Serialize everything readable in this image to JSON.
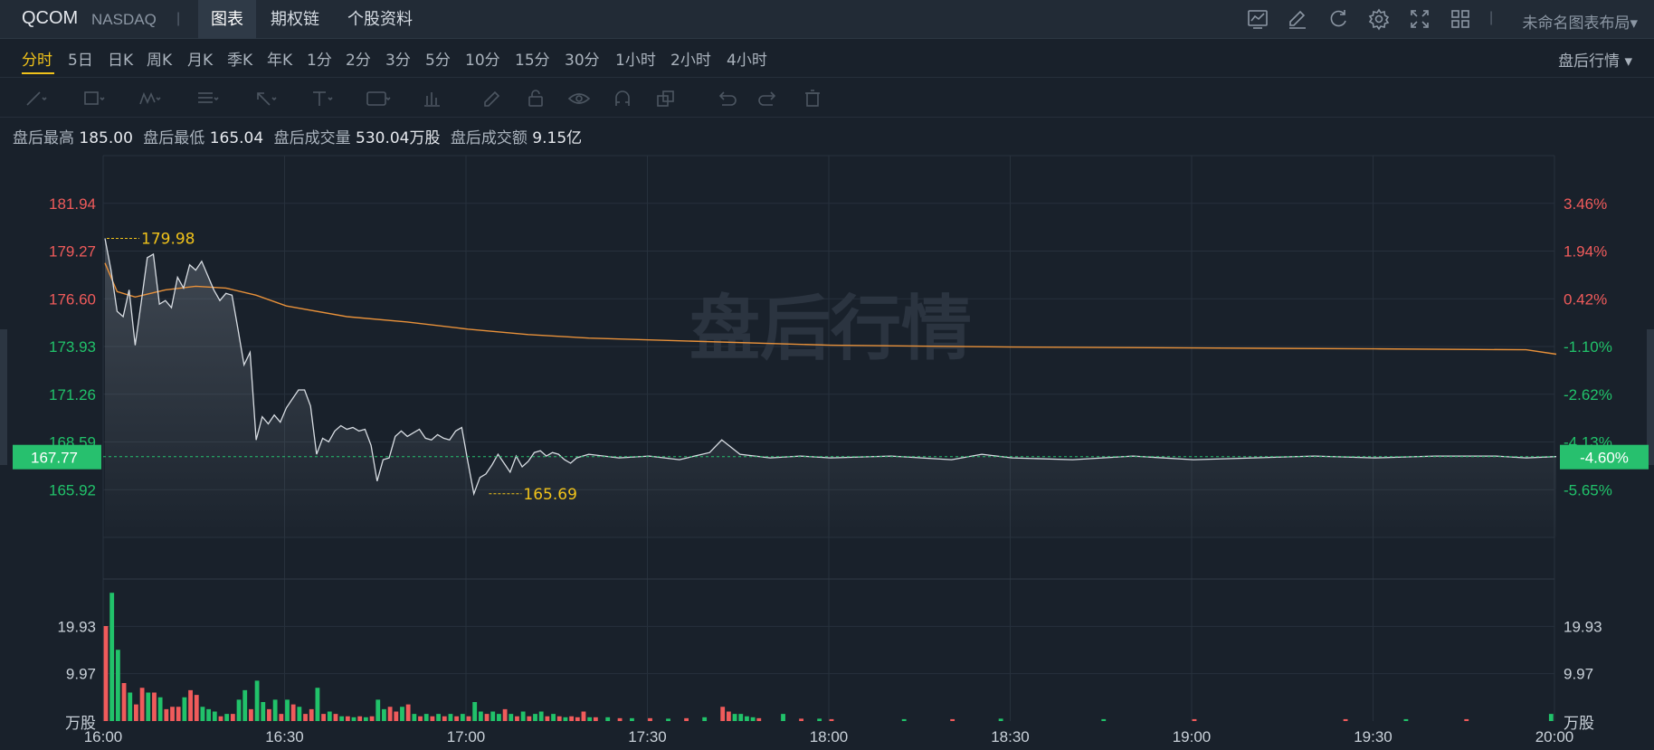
{
  "header": {
    "symbol": "QCOM",
    "exchange": "NASDAQ",
    "separator": "|",
    "tabs": [
      {
        "label": "图表",
        "active": true
      },
      {
        "label": "期权链",
        "active": false
      },
      {
        "label": "个股资料",
        "active": false
      }
    ],
    "icons": [
      "chart-type-icon",
      "draw-icon",
      "refresh-icon",
      "settings-icon",
      "fullscreen-icon",
      "layout-grid-icon"
    ],
    "layout_name": "未命名图表布局▾"
  },
  "periods": {
    "items": [
      "分时",
      "5日",
      "日K",
      "周K",
      "月K",
      "季K",
      "年K",
      "1分",
      "2分",
      "3分",
      "5分",
      "10分",
      "15分",
      "30分",
      "1小时",
      "2小时",
      "4小时"
    ],
    "active": "分时",
    "session_select": "盘后行情  ▾"
  },
  "drawing_tools": [
    "line-tool-icon",
    "rect-tool-icon",
    "wave-tool-icon",
    "fib-tool-icon",
    "arrow-tool-icon",
    "text-tool-icon",
    "label-tool-icon",
    "measure-tool-icon",
    "pen-tool-icon",
    "lock-icon",
    "eye-icon",
    "magnet-icon",
    "copy-icon",
    "undo-icon",
    "redo-icon",
    "trash-icon"
  ],
  "stats": [
    {
      "label": "盘后最高",
      "value": "185.00"
    },
    {
      "label": "盘后最低",
      "value": "165.04"
    },
    {
      "label": "盘后成交量",
      "value": "530.04万股"
    },
    {
      "label": "盘后成交额",
      "value": "9.15亿"
    }
  ],
  "colors": {
    "up": "#f05b5b",
    "down": "#21c26a",
    "price_line": "#d8dde3",
    "avg_line": "#e8913a",
    "highlight": "#f0c21a",
    "current_badge": "#27c06e"
  },
  "chart_data": {
    "type": "line",
    "watermark": "盘后行情",
    "x_ticks": [
      "16:00",
      "16:30",
      "17:00",
      "17:30",
      "18:00",
      "18:30",
      "19:00",
      "19:30",
      "20:00"
    ],
    "x_range": [
      "16:00",
      "20:00"
    ],
    "price_axis": {
      "ticks": [
        "181.94",
        "179.27",
        "176.60",
        "173.93",
        "171.26",
        "168.59",
        "165.92"
      ],
      "tick_colors": [
        "up",
        "up",
        "up",
        "down",
        "down",
        "down",
        "down"
      ],
      "ylim": [
        163.25,
        184.61
      ],
      "reference_price": 175.87
    },
    "percent_axis": {
      "ticks": [
        "3.46%",
        "1.94%",
        "0.42%",
        "-1.10%",
        "-2.62%",
        "-4.13%",
        "-5.65%"
      ],
      "tick_colors": [
        "up",
        "up",
        "up",
        "down",
        "down",
        "down",
        "down"
      ]
    },
    "current": {
      "price": "167.77",
      "change_pct": "-4.60%"
    },
    "annotations": {
      "high": {
        "time": "16:00",
        "value": 179.98,
        "label": "179.98"
      },
      "low": {
        "time": "17:05",
        "value": 165.69,
        "label": "165.69"
      }
    },
    "price_series": [
      [
        "16:00",
        179.98
      ],
      [
        "16:01",
        178.2
      ],
      [
        "16:02",
        175.9
      ],
      [
        "16:03",
        175.6
      ],
      [
        "16:04",
        177.1
      ],
      [
        "16:05",
        174.0
      ],
      [
        "16:06",
        176.4
      ],
      [
        "16:07",
        178.9
      ],
      [
        "16:08",
        179.1
      ],
      [
        "16:09",
        176.3
      ],
      [
        "16:10",
        176.5
      ],
      [
        "16:11",
        176.1
      ],
      [
        "16:12",
        177.8
      ],
      [
        "16:13",
        177.2
      ],
      [
        "16:14",
        178.5
      ],
      [
        "16:15",
        178.2
      ],
      [
        "16:16",
        178.7
      ],
      [
        "16:17",
        177.9
      ],
      [
        "16:18",
        177.1
      ],
      [
        "16:19",
        176.5
      ],
      [
        "16:20",
        176.9
      ],
      [
        "16:21",
        176.8
      ],
      [
        "16:22",
        174.9
      ],
      [
        "16:23",
        172.9
      ],
      [
        "16:24",
        173.6
      ],
      [
        "16:25",
        168.7
      ],
      [
        "16:26",
        170.0
      ],
      [
        "16:27",
        169.6
      ],
      [
        "16:28",
        170.1
      ],
      [
        "16:29",
        169.7
      ],
      [
        "16:30",
        170.5
      ],
      [
        "16:31",
        171.0
      ],
      [
        "16:32",
        171.5
      ],
      [
        "16:33",
        171.5
      ],
      [
        "16:34",
        170.6
      ],
      [
        "16:35",
        167.9
      ],
      [
        "16:36",
        168.8
      ],
      [
        "16:37",
        168.6
      ],
      [
        "16:38",
        169.2
      ],
      [
        "16:39",
        169.5
      ],
      [
        "16:40",
        169.3
      ],
      [
        "16:41",
        169.4
      ],
      [
        "16:42",
        169.2
      ],
      [
        "16:43",
        169.3
      ],
      [
        "16:44",
        168.4
      ],
      [
        "16:45",
        166.4
      ],
      [
        "16:46",
        167.6
      ],
      [
        "16:47",
        167.7
      ],
      [
        "16:48",
        168.9
      ],
      [
        "16:49",
        169.2
      ],
      [
        "16:50",
        168.9
      ],
      [
        "16:51",
        169.1
      ],
      [
        "16:52",
        169.3
      ],
      [
        "16:53",
        168.8
      ],
      [
        "16:54",
        168.7
      ],
      [
        "16:55",
        169.0
      ],
      [
        "16:56",
        168.8
      ],
      [
        "16:57",
        168.7
      ],
      [
        "16:58",
        169.2
      ],
      [
        "16:59",
        169.4
      ],
      [
        "17:00",
        167.5
      ],
      [
        "17:01",
        165.69
      ],
      [
        "17:02",
        166.6
      ],
      [
        "17:03",
        166.8
      ],
      [
        "17:04",
        167.3
      ],
      [
        "17:05",
        167.9
      ],
      [
        "17:06",
        167.4
      ],
      [
        "17:07",
        166.9
      ],
      [
        "17:08",
        167.8
      ],
      [
        "17:09",
        167.2
      ],
      [
        "17:10",
        167.5
      ],
      [
        "17:11",
        168.0
      ],
      [
        "17:12",
        168.1
      ],
      [
        "17:13",
        167.8
      ],
      [
        "17:14",
        168.0
      ],
      [
        "17:15",
        167.9
      ],
      [
        "17:16",
        167.6
      ],
      [
        "17:17",
        167.4
      ],
      [
        "17:18",
        167.7
      ],
      [
        "17:19",
        167.8
      ],
      [
        "17:20",
        167.9
      ],
      [
        "17:25",
        167.7
      ],
      [
        "17:30",
        167.8
      ],
      [
        "17:35",
        167.6
      ],
      [
        "17:40",
        168.0
      ],
      [
        "17:42",
        168.7
      ],
      [
        "17:45",
        167.9
      ],
      [
        "17:50",
        167.7
      ],
      [
        "17:55",
        167.8
      ],
      [
        "18:00",
        167.7
      ],
      [
        "18:10",
        167.8
      ],
      [
        "18:20",
        167.6
      ],
      [
        "18:25",
        167.9
      ],
      [
        "18:30",
        167.7
      ],
      [
        "18:40",
        167.6
      ],
      [
        "18:50",
        167.8
      ],
      [
        "19:00",
        167.6
      ],
      [
        "19:10",
        167.7
      ],
      [
        "19:20",
        167.8
      ],
      [
        "19:30",
        167.7
      ],
      [
        "19:40",
        167.8
      ],
      [
        "19:50",
        167.8
      ],
      [
        "19:55",
        167.7
      ],
      [
        "20:00",
        167.77
      ]
    ],
    "avg_series": [
      [
        "16:00",
        178.6
      ],
      [
        "16:02",
        177.0
      ],
      [
        "16:05",
        176.7
      ],
      [
        "16:10",
        177.1
      ],
      [
        "16:15",
        177.3
      ],
      [
        "16:20",
        177.2
      ],
      [
        "16:25",
        176.8
      ],
      [
        "16:30",
        176.2
      ],
      [
        "16:40",
        175.6
      ],
      [
        "16:50",
        175.3
      ],
      [
        "17:00",
        174.9
      ],
      [
        "17:10",
        174.6
      ],
      [
        "17:20",
        174.4
      ],
      [
        "17:30",
        174.3
      ],
      [
        "18:00",
        174.0
      ],
      [
        "18:30",
        173.9
      ],
      [
        "19:00",
        173.85
      ],
      [
        "19:30",
        173.8
      ],
      [
        "19:55",
        173.75
      ],
      [
        "20:00",
        173.5
      ]
    ],
    "volume_axis": {
      "ticks": [
        "19.93",
        "9.97"
      ],
      "unit": "万股",
      "ylim": [
        0,
        29.9
      ]
    },
    "volume_series": [
      {
        "t": "16:00",
        "v": 20.0,
        "d": "up"
      },
      {
        "t": "16:01",
        "v": 27.0,
        "d": "down"
      },
      {
        "t": "16:02",
        "v": 15.0,
        "d": "down"
      },
      {
        "t": "16:03",
        "v": 8.0,
        "d": "up"
      },
      {
        "t": "16:04",
        "v": 6.0,
        "d": "down"
      },
      {
        "t": "16:05",
        "v": 3.5,
        "d": "up"
      },
      {
        "t": "16:06",
        "v": 7.0,
        "d": "up"
      },
      {
        "t": "16:07",
        "v": 6.0,
        "d": "down"
      },
      {
        "t": "16:08",
        "v": 6.0,
        "d": "up"
      },
      {
        "t": "16:09",
        "v": 5.0,
        "d": "down"
      },
      {
        "t": "16:10",
        "v": 2.5,
        "d": "up"
      },
      {
        "t": "16:11",
        "v": 3.0,
        "d": "up"
      },
      {
        "t": "16:12",
        "v": 3.0,
        "d": "up"
      },
      {
        "t": "16:13",
        "v": 5.0,
        "d": "down"
      },
      {
        "t": "16:14",
        "v": 6.5,
        "d": "up"
      },
      {
        "t": "16:15",
        "v": 5.5,
        "d": "up"
      },
      {
        "t": "16:16",
        "v": 3.0,
        "d": "down"
      },
      {
        "t": "16:17",
        "v": 2.5,
        "d": "down"
      },
      {
        "t": "16:18",
        "v": 2.0,
        "d": "down"
      },
      {
        "t": "16:19",
        "v": 1.0,
        "d": "up"
      },
      {
        "t": "16:20",
        "v": 1.5,
        "d": "down"
      },
      {
        "t": "16:21",
        "v": 1.5,
        "d": "up"
      },
      {
        "t": "16:22",
        "v": 4.5,
        "d": "down"
      },
      {
        "t": "16:23",
        "v": 6.5,
        "d": "down"
      },
      {
        "t": "16:24",
        "v": 2.5,
        "d": "up"
      },
      {
        "t": "16:25",
        "v": 8.5,
        "d": "down"
      },
      {
        "t": "16:26",
        "v": 4.0,
        "d": "down"
      },
      {
        "t": "16:27",
        "v": 2.5,
        "d": "up"
      },
      {
        "t": "16:28",
        "v": 4.5,
        "d": "down"
      },
      {
        "t": "16:29",
        "v": 1.5,
        "d": "up"
      },
      {
        "t": "16:30",
        "v": 4.5,
        "d": "down"
      },
      {
        "t": "16:31",
        "v": 3.5,
        "d": "up"
      },
      {
        "t": "16:32",
        "v": 3.0,
        "d": "down"
      },
      {
        "t": "16:33",
        "v": 1.5,
        "d": "up"
      },
      {
        "t": "16:34",
        "v": 2.5,
        "d": "up"
      },
      {
        "t": "16:35",
        "v": 7.0,
        "d": "down"
      },
      {
        "t": "16:36",
        "v": 1.5,
        "d": "up"
      },
      {
        "t": "16:37",
        "v": 2.0,
        "d": "down"
      },
      {
        "t": "16:38",
        "v": 1.5,
        "d": "up"
      },
      {
        "t": "16:39",
        "v": 1.0,
        "d": "down"
      },
      {
        "t": "16:40",
        "v": 1.0,
        "d": "up"
      },
      {
        "t": "16:41",
        "v": 0.8,
        "d": "down"
      },
      {
        "t": "16:42",
        "v": 1.0,
        "d": "up"
      },
      {
        "t": "16:43",
        "v": 0.8,
        "d": "down"
      },
      {
        "t": "16:44",
        "v": 1.0,
        "d": "up"
      },
      {
        "t": "16:45",
        "v": 4.5,
        "d": "down"
      },
      {
        "t": "16:46",
        "v": 2.5,
        "d": "down"
      },
      {
        "t": "16:47",
        "v": 3.0,
        "d": "up"
      },
      {
        "t": "16:48",
        "v": 2.0,
        "d": "up"
      },
      {
        "t": "16:49",
        "v": 3.0,
        "d": "down"
      },
      {
        "t": "16:50",
        "v": 3.5,
        "d": "up"
      },
      {
        "t": "16:51",
        "v": 1.5,
        "d": "down"
      },
      {
        "t": "16:52",
        "v": 1.0,
        "d": "up"
      },
      {
        "t": "16:53",
        "v": 1.5,
        "d": "down"
      },
      {
        "t": "16:54",
        "v": 1.0,
        "d": "up"
      },
      {
        "t": "16:55",
        "v": 1.5,
        "d": "down"
      },
      {
        "t": "16:56",
        "v": 1.0,
        "d": "up"
      },
      {
        "t": "16:57",
        "v": 1.5,
        "d": "down"
      },
      {
        "t": "16:58",
        "v": 1.0,
        "d": "up"
      },
      {
        "t": "16:59",
        "v": 1.5,
        "d": "down"
      },
      {
        "t": "17:00",
        "v": 1.0,
        "d": "up"
      },
      {
        "t": "17:01",
        "v": 4.0,
        "d": "down"
      },
      {
        "t": "17:02",
        "v": 2.0,
        "d": "down"
      },
      {
        "t": "17:03",
        "v": 1.5,
        "d": "up"
      },
      {
        "t": "17:04",
        "v": 2.0,
        "d": "down"
      },
      {
        "t": "17:05",
        "v": 1.5,
        "d": "down"
      },
      {
        "t": "17:06",
        "v": 2.5,
        "d": "up"
      },
      {
        "t": "17:07",
        "v": 1.5,
        "d": "down"
      },
      {
        "t": "17:08",
        "v": 1.0,
        "d": "up"
      },
      {
        "t": "17:09",
        "v": 2.0,
        "d": "down"
      },
      {
        "t": "17:10",
        "v": 1.0,
        "d": "up"
      },
      {
        "t": "17:11",
        "v": 1.5,
        "d": "down"
      },
      {
        "t": "17:12",
        "v": 2.0,
        "d": "down"
      },
      {
        "t": "17:13",
        "v": 1.0,
        "d": "up"
      },
      {
        "t": "17:14",
        "v": 1.5,
        "d": "down"
      },
      {
        "t": "17:15",
        "v": 1.0,
        "d": "up"
      },
      {
        "t": "17:16",
        "v": 0.8,
        "d": "down"
      },
      {
        "t": "17:17",
        "v": 1.0,
        "d": "up"
      },
      {
        "t": "17:18",
        "v": 0.8,
        "d": "up"
      },
      {
        "t": "17:19",
        "v": 2.0,
        "d": "up"
      },
      {
        "t": "17:20",
        "v": 0.8,
        "d": "down"
      },
      {
        "t": "17:21",
        "v": 0.8,
        "d": "up"
      },
      {
        "t": "17:23",
        "v": 0.8,
        "d": "down"
      },
      {
        "t": "17:25",
        "v": 0.6,
        "d": "up"
      },
      {
        "t": "17:27",
        "v": 0.6,
        "d": "down"
      },
      {
        "t": "17:30",
        "v": 0.6,
        "d": "up"
      },
      {
        "t": "17:33",
        "v": 0.5,
        "d": "down"
      },
      {
        "t": "17:36",
        "v": 0.6,
        "d": "up"
      },
      {
        "t": "17:39",
        "v": 0.8,
        "d": "down"
      },
      {
        "t": "17:42",
        "v": 3.0,
        "d": "up"
      },
      {
        "t": "17:43",
        "v": 2.0,
        "d": "up"
      },
      {
        "t": "17:44",
        "v": 1.5,
        "d": "down"
      },
      {
        "t": "17:45",
        "v": 1.5,
        "d": "down"
      },
      {
        "t": "17:46",
        "v": 1.0,
        "d": "down"
      },
      {
        "t": "17:47",
        "v": 0.8,
        "d": "down"
      },
      {
        "t": "17:48",
        "v": 0.6,
        "d": "up"
      },
      {
        "t": "17:52",
        "v": 1.5,
        "d": "down"
      },
      {
        "t": "17:55",
        "v": 0.5,
        "d": "up"
      },
      {
        "t": "17:58",
        "v": 0.5,
        "d": "down"
      },
      {
        "t": "18:00",
        "v": 0.4,
        "d": "up"
      },
      {
        "t": "18:12",
        "v": 0.4,
        "d": "down"
      },
      {
        "t": "18:20",
        "v": 0.4,
        "d": "up"
      },
      {
        "t": "18:28",
        "v": 0.5,
        "d": "down"
      },
      {
        "t": "18:45",
        "v": 0.4,
        "d": "down"
      },
      {
        "t": "19:00",
        "v": 0.4,
        "d": "up"
      },
      {
        "t": "19:25",
        "v": 0.4,
        "d": "up"
      },
      {
        "t": "19:35",
        "v": 0.4,
        "d": "down"
      },
      {
        "t": "19:45",
        "v": 0.4,
        "d": "up"
      },
      {
        "t": "19:59",
        "v": 1.5,
        "d": "down"
      }
    ]
  }
}
